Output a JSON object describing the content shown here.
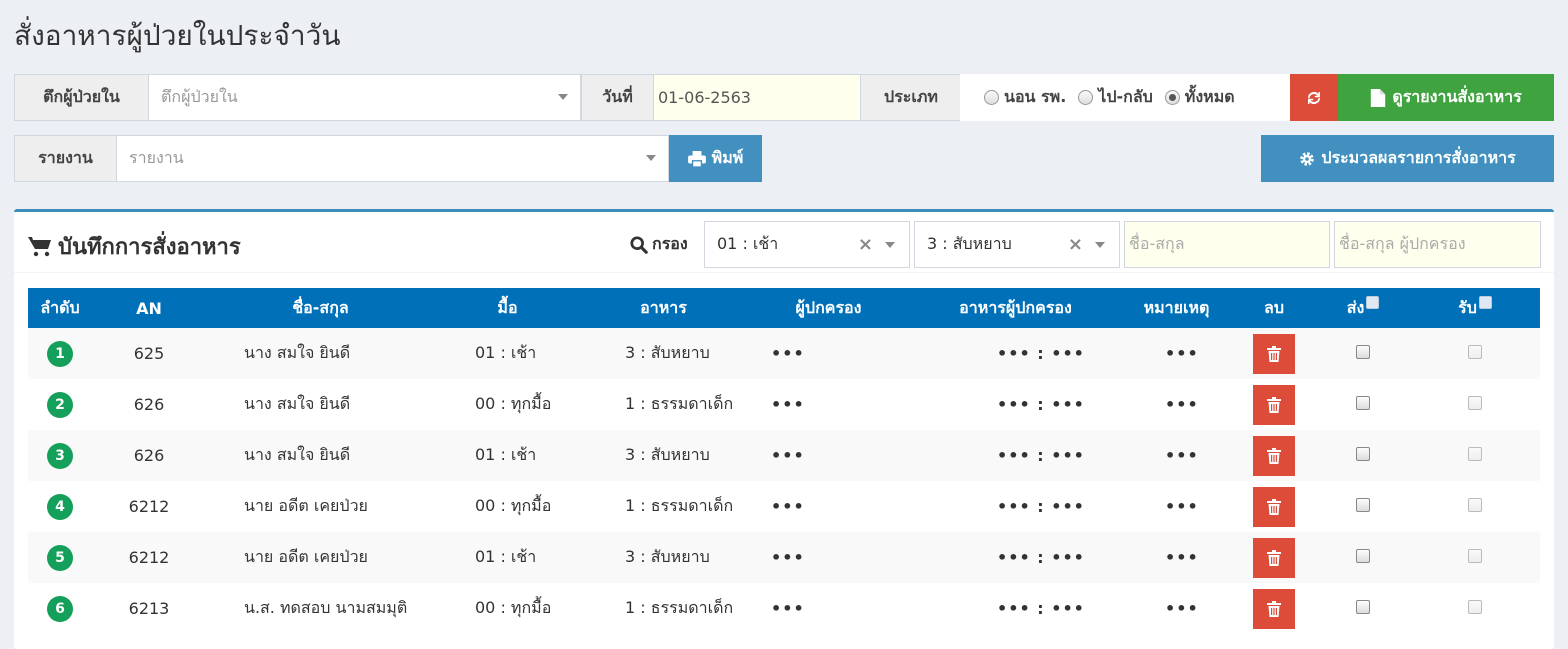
{
  "page": {
    "title": "สั่งอาหารผู้ป่วยในประจำวัน"
  },
  "filters": {
    "ward_label": "ตึกผู้ป่วยใน",
    "ward_placeholder": "ตึกผู้ป่วยใน",
    "date_label": "วันที่",
    "date_value": "01-06-2563",
    "type_label": "ประเภท",
    "type_options": [
      "นอน รพ.",
      "ไป-กลับ",
      "ทั้งหมด"
    ],
    "type_selected": "ทั้งหมด",
    "refresh_icon": "refresh-icon",
    "view_report_label": "ดูรายงานสั่งอาหาร",
    "report_label": "รายงาน",
    "report_placeholder": "รายงาน",
    "print_label": "พิมพ์",
    "process_label": "ประมวลผลรายการสั่งอาหาร"
  },
  "box": {
    "title": "บันทึกการสั่งอาหาร",
    "filter_label": "กรอง",
    "meal_filter": "01 : เช้า",
    "food_filter": "3 : สับหยาบ",
    "name_placeholder": "ชื่อ-สกุล",
    "guardian_placeholder": "ชื่อ-สกุล ผู้ปกครอง"
  },
  "table": {
    "headers": [
      "ลำดับ",
      "AN",
      "ชื่อ-สกุล",
      "มื้อ",
      "อาหาร",
      "ผู้ปกครอง",
      "อาหารผู้ปกครอง",
      "หมายเหตุ",
      "ลบ",
      "ส่ง",
      "รับ"
    ],
    "rows": [
      {
        "no": "1",
        "an": "625",
        "name": "นาง สมใจ ยินดี",
        "meal": "01 : เช้า",
        "food": "3 : สับหยาบ",
        "guardian": "•••",
        "guardian_food": "••• : •••",
        "note": "•••"
      },
      {
        "no": "2",
        "an": "626",
        "name": "นาง สมใจ ยินดี",
        "meal": "00 : ทุกมื้อ",
        "food": "1 : ธรรมดาเด็ก",
        "guardian": "•••",
        "guardian_food": "••• : •••",
        "note": "•••"
      },
      {
        "no": "3",
        "an": "626",
        "name": "นาง สมใจ ยินดี",
        "meal": "01 : เช้า",
        "food": "3 : สับหยาบ",
        "guardian": "•••",
        "guardian_food": "••• : •••",
        "note": "•••"
      },
      {
        "no": "4",
        "an": "6212",
        "name": "นาย อดีต เคยป่วย",
        "meal": "00 : ทุกมื้อ",
        "food": "1 : ธรรมดาเด็ก",
        "guardian": "•••",
        "guardian_food": "••• : •••",
        "note": "•••"
      },
      {
        "no": "5",
        "an": "6212",
        "name": "นาย อดีต เคยป่วย",
        "meal": "01 : เช้า",
        "food": "3 : สับหยาบ",
        "guardian": "•••",
        "guardian_food": "••• : •••",
        "note": "•••"
      },
      {
        "no": "6",
        "an": "6213",
        "name": "น.ส. ทดสอบ นามสมมุติ",
        "meal": "00 : ทุกมื้อ",
        "food": "1 : ธรรมดาเด็ก",
        "guardian": "•••",
        "guardian_food": "••• : •••",
        "note": "•••"
      }
    ]
  },
  "colors": {
    "header_blue": "#0070b8",
    "danger": "#dd4b39",
    "success": "#3fa33f",
    "primary": "#4190c0",
    "badge": "#14a05a"
  }
}
